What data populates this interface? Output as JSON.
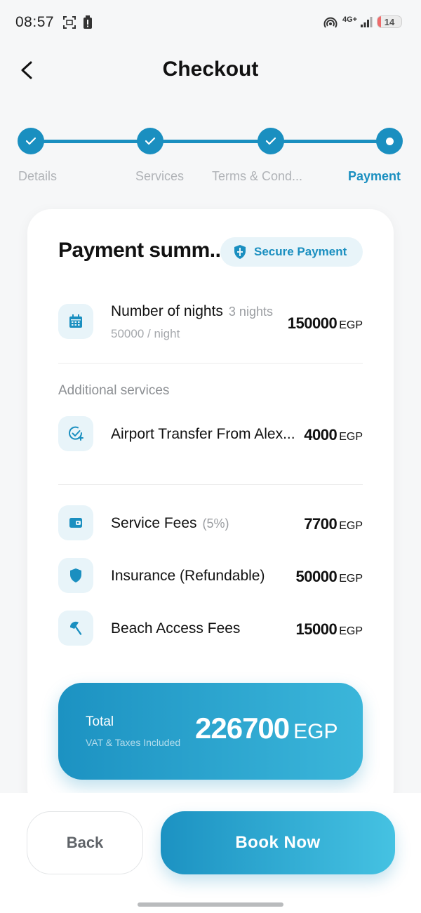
{
  "status_bar": {
    "time": "08:57",
    "network": "4G+",
    "battery": "14",
    "battery_level": 0.14,
    "battery_color": "#ef6b6b"
  },
  "header": {
    "title": "Checkout"
  },
  "stepper": {
    "steps": [
      {
        "label": "Details",
        "state": "done"
      },
      {
        "label": "Services",
        "state": "done"
      },
      {
        "label": "Terms & Cond...",
        "state": "done"
      },
      {
        "label": "Payment",
        "state": "current"
      }
    ],
    "accent": "#1a8fc0"
  },
  "summary": {
    "title": "Payment summ...",
    "secure_label": "Secure Payment",
    "nights": {
      "label": "Number of nights",
      "count": "3 nights",
      "rate": "50000 / night",
      "amount": "150000",
      "currency": "EGP",
      "icon": "calendar-icon"
    },
    "additional_label": "Additional services",
    "services": [
      {
        "label": "Airport Transfer From Alex...",
        "amount": "4000",
        "currency": "EGP",
        "icon": "check-add-icon"
      }
    ],
    "fees": [
      {
        "label": "Service Fees",
        "note": "(5%)",
        "amount": "7700",
        "currency": "EGP",
        "icon": "wallet-icon"
      },
      {
        "label": "Insurance (Refundable)",
        "note": "",
        "amount": "50000",
        "currency": "EGP",
        "icon": "shield-icon"
      },
      {
        "label": "Beach Access Fees",
        "note": "",
        "amount": "15000",
        "currency": "EGP",
        "icon": "beach-umbrella-icon"
      }
    ],
    "total": {
      "label": "Total",
      "sub": "VAT & Taxes Included",
      "amount": "226700",
      "currency": "EGP"
    }
  },
  "actions": {
    "back_label": "Back",
    "book_label": "Book Now"
  }
}
